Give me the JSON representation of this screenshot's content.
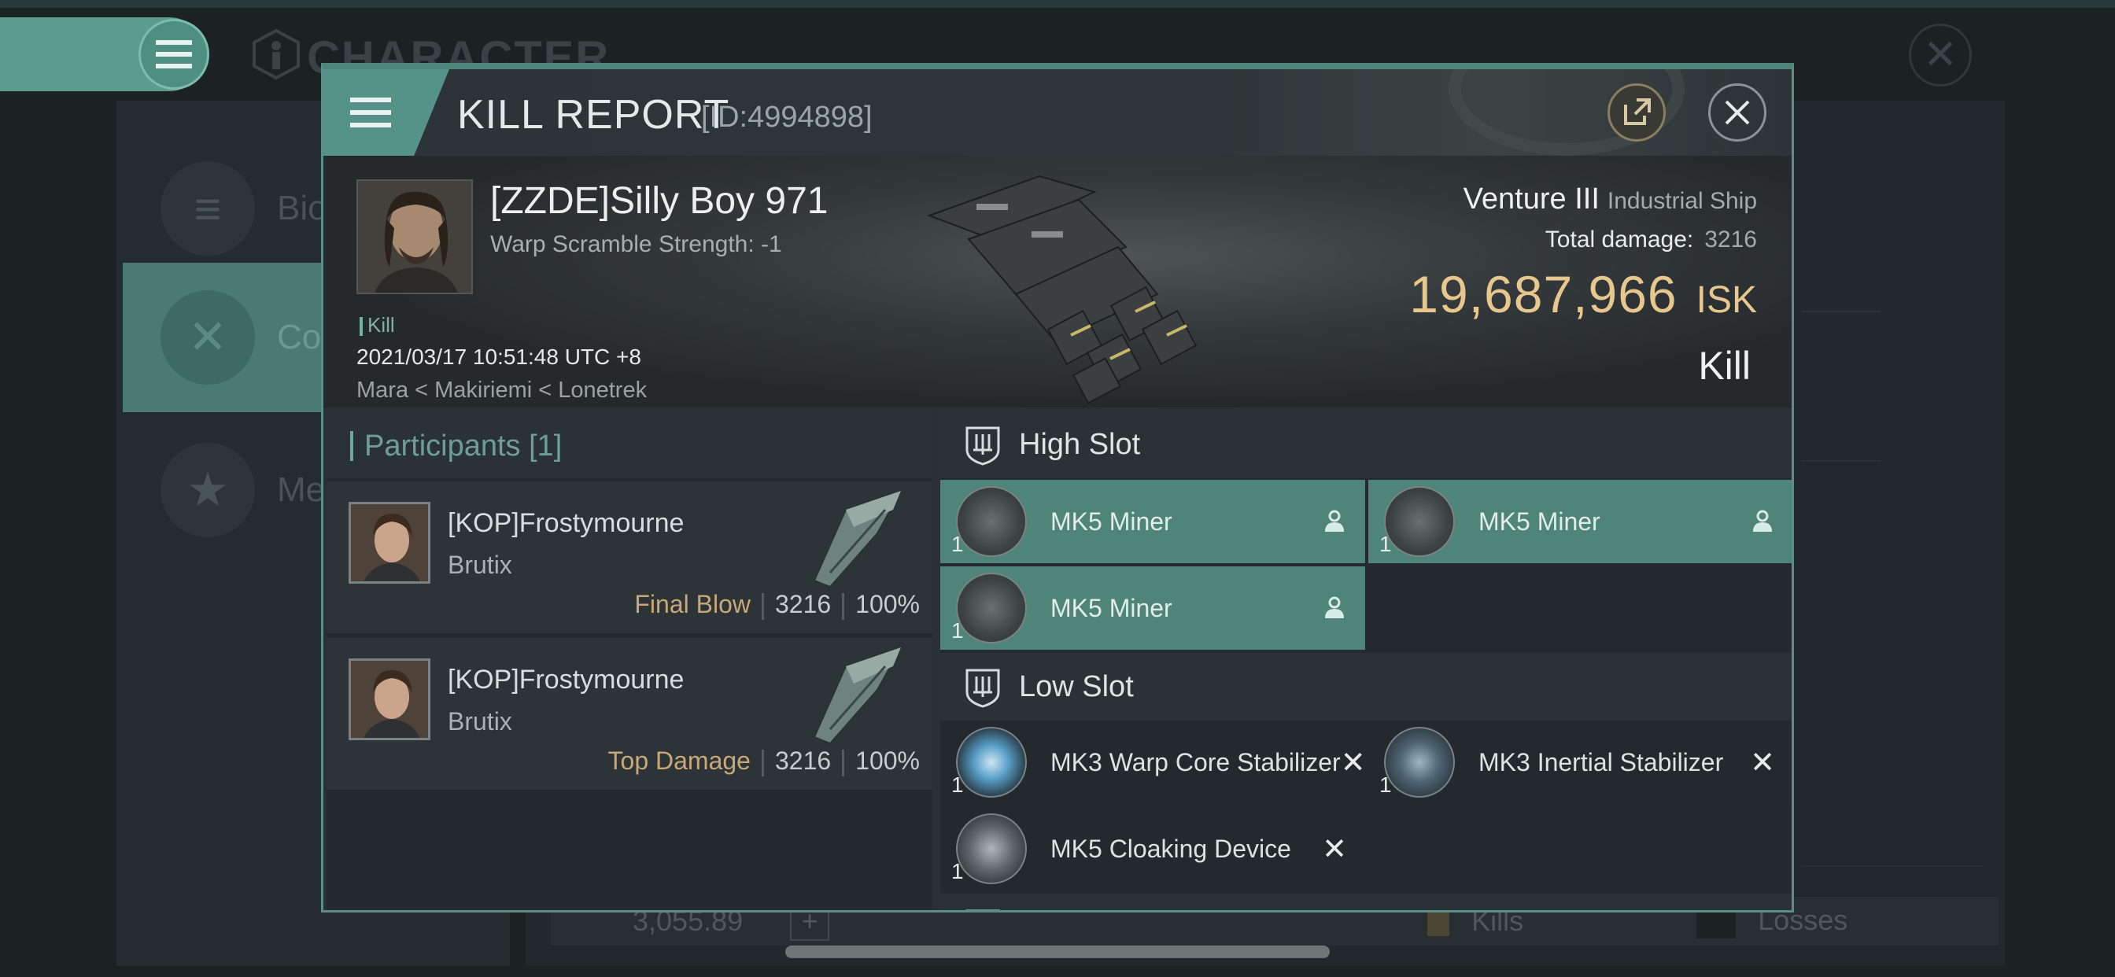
{
  "background": {
    "screen_title": "CHARACTER",
    "sidebar": [
      {
        "label": "Bio",
        "icon": "hamburger-icon"
      },
      {
        "label": "Con",
        "icon": "crossed-swords-icon",
        "active": true
      },
      {
        "label": "Med",
        "icon": "star-badge-icon"
      }
    ],
    "bottom_bar": {
      "amount": "3,055.89",
      "kills_label": "Kills",
      "losses_label": "Losses"
    }
  },
  "report": {
    "title": "KILL REPORT",
    "id_text": "[ID:4994898]"
  },
  "victim": {
    "name": "[ZZDE]Silly Boy 971",
    "warp": "Warp Scramble Strength: -1",
    "tag": "Kill",
    "time": "2021/03/17 10:51:48 UTC +8",
    "location": "Mara < Makiriemi < Lonetrek",
    "ship_name": "Venture III",
    "ship_class": "Industrial Ship",
    "damage_label": "Total damage:",
    "damage_value": "3216",
    "isk_value": "19,687,966",
    "isk_unit": "ISK",
    "result": "Kill"
  },
  "participants": {
    "heading": "Participants [1]",
    "rows": [
      {
        "name": "[KOP]Frostymourne",
        "ship": "Brutix",
        "role": "Final Blow",
        "damage": "3216",
        "percent": "100%"
      },
      {
        "name": "[KOP]Frostymourne",
        "ship": "Brutix",
        "role": "Top Damage",
        "damage": "3216",
        "percent": "100%"
      }
    ]
  },
  "fittings": {
    "high_slot": {
      "heading": "High Slot",
      "modules": [
        {
          "name": "MK5 Miner",
          "qty": "1",
          "status_icon": "person-icon"
        },
        {
          "name": "MK5 Miner",
          "qty": "1",
          "status_icon": "person-icon"
        },
        {
          "name": "MK5 Miner",
          "qty": "1",
          "status_icon": "person-icon"
        }
      ]
    },
    "low_slot": {
      "heading": "Low Slot",
      "modules": [
        {
          "name": "MK3 Warp Core Stabilizer",
          "qty": "1",
          "status_icon": "destroyed-x-icon"
        },
        {
          "name": "MK3 Inertial Stabilizer",
          "qty": "1",
          "status_icon": "destroyed-x-icon"
        },
        {
          "name": "MK5 Cloaking Device",
          "qty": "1",
          "status_icon": "destroyed-x-icon"
        }
      ]
    }
  },
  "colors": {
    "accent": "#4f8578",
    "isk": "#e8c78e",
    "role": "#c8a877"
  }
}
